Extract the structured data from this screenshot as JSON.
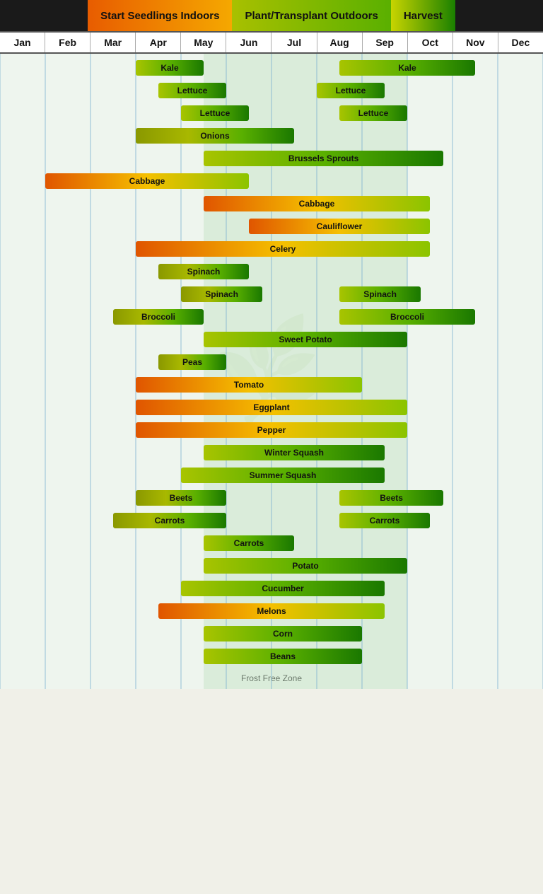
{
  "legend": {
    "items": [
      {
        "label": "Start Seedlings Indoors",
        "type": "seedlings"
      },
      {
        "label": "Plant/Transplant Outdoors",
        "type": "plant"
      },
      {
        "label": "Harvest",
        "type": "harvest"
      }
    ]
  },
  "months": [
    "Jan",
    "Feb",
    "Mar",
    "Apr",
    "May",
    "Jun",
    "Jul",
    "Aug",
    "Sep",
    "Oct",
    "Nov",
    "Dec"
  ],
  "footer": "Frost Free Zone",
  "chart": {
    "total_months": 12,
    "rows": [
      {
        "label": "Kale",
        "bars": [
          {
            "start": 3.0,
            "end": 4.5,
            "type": "plant",
            "label": "Kale"
          },
          {
            "start": 7.5,
            "end": 10.5,
            "type": "plant",
            "label": "Kale"
          }
        ]
      },
      {
        "label": "Lettuce1",
        "bars": [
          {
            "start": 3.5,
            "end": 5.0,
            "type": "plant",
            "label": "Lettuce"
          },
          {
            "start": 7.0,
            "end": 8.5,
            "type": "plant",
            "label": "Lettuce"
          }
        ]
      },
      {
        "label": "Lettuce2",
        "bars": [
          {
            "start": 4.0,
            "end": 5.5,
            "type": "plant",
            "label": "Lettuce"
          },
          {
            "start": 7.5,
            "end": 9.0,
            "type": "plant",
            "label": "Lettuce"
          }
        ]
      },
      {
        "label": "Onions",
        "bars": [
          {
            "start": 3.0,
            "end": 6.5,
            "type": "olive",
            "label": "Onions"
          }
        ]
      },
      {
        "label": "Brussels Sprouts",
        "bars": [
          {
            "start": 4.5,
            "end": 9.8,
            "type": "plant",
            "label": "Brussels Sprouts"
          }
        ]
      },
      {
        "label": "Cabbage1",
        "bars": [
          {
            "start": 1.0,
            "end": 5.5,
            "type": "seedling",
            "label": "Cabbage"
          }
        ]
      },
      {
        "label": "Cabbage2",
        "bars": [
          {
            "start": 4.5,
            "end": 9.5,
            "type": "seedling",
            "label": "Cabbage"
          }
        ]
      },
      {
        "label": "Cauliflower",
        "bars": [
          {
            "start": 5.5,
            "end": 9.5,
            "type": "seedling",
            "label": "Cauliflower"
          }
        ]
      },
      {
        "label": "Celery",
        "bars": [
          {
            "start": 3.0,
            "end": 9.5,
            "type": "seedling",
            "label": "Celery"
          }
        ]
      },
      {
        "label": "Spinach1",
        "bars": [
          {
            "start": 3.5,
            "end": 5.5,
            "type": "olive",
            "label": "Spinach"
          }
        ]
      },
      {
        "label": "Spinach2",
        "bars": [
          {
            "start": 4.0,
            "end": 5.8,
            "type": "olive",
            "label": "Spinach"
          },
          {
            "start": 7.5,
            "end": 9.3,
            "type": "plant",
            "label": "Spinach"
          }
        ]
      },
      {
        "label": "Broccoli",
        "bars": [
          {
            "start": 2.5,
            "end": 4.5,
            "type": "olive",
            "label": "Broccoli"
          },
          {
            "start": 7.5,
            "end": 10.5,
            "type": "plant",
            "label": "Broccoli"
          }
        ]
      },
      {
        "label": "Sweet Potato",
        "bars": [
          {
            "start": 4.5,
            "end": 9.0,
            "type": "plant",
            "label": "Sweet Potato"
          }
        ]
      },
      {
        "label": "Peas",
        "bars": [
          {
            "start": 3.5,
            "end": 5.0,
            "type": "olive",
            "label": "Peas"
          }
        ]
      },
      {
        "label": "Tomato",
        "bars": [
          {
            "start": 3.0,
            "end": 8.0,
            "type": "seedling",
            "label": "Tomato"
          }
        ]
      },
      {
        "label": "Eggplant",
        "bars": [
          {
            "start": 3.0,
            "end": 9.0,
            "type": "seedling",
            "label": "Eggplant"
          }
        ]
      },
      {
        "label": "Pepper",
        "bars": [
          {
            "start": 3.0,
            "end": 9.0,
            "type": "seedling",
            "label": "Pepper"
          }
        ]
      },
      {
        "label": "Winter Squash",
        "bars": [
          {
            "start": 4.5,
            "end": 8.5,
            "type": "plant",
            "label": "Winter Squash"
          }
        ]
      },
      {
        "label": "Summer Squash",
        "bars": [
          {
            "start": 4.0,
            "end": 8.5,
            "type": "plant",
            "label": "Summer Squash"
          }
        ]
      },
      {
        "label": "Beets",
        "bars": [
          {
            "start": 3.0,
            "end": 5.0,
            "type": "olive",
            "label": "Beets"
          },
          {
            "start": 7.5,
            "end": 9.8,
            "type": "plant",
            "label": "Beets"
          }
        ]
      },
      {
        "label": "Carrots1",
        "bars": [
          {
            "start": 2.5,
            "end": 5.0,
            "type": "olive",
            "label": "Carrots"
          },
          {
            "start": 7.5,
            "end": 9.5,
            "type": "plant",
            "label": "Carrots"
          }
        ]
      },
      {
        "label": "Carrots2",
        "bars": [
          {
            "start": 4.5,
            "end": 6.5,
            "type": "plant",
            "label": "Carrots"
          }
        ]
      },
      {
        "label": "Potato",
        "bars": [
          {
            "start": 4.5,
            "end": 9.0,
            "type": "plant",
            "label": "Potato"
          }
        ]
      },
      {
        "label": "Cucumber",
        "bars": [
          {
            "start": 4.0,
            "end": 8.5,
            "type": "plant",
            "label": "Cucumber"
          }
        ]
      },
      {
        "label": "Melons",
        "bars": [
          {
            "start": 3.5,
            "end": 8.5,
            "type": "seedling",
            "label": "Melons"
          }
        ]
      },
      {
        "label": "Corn",
        "bars": [
          {
            "start": 4.5,
            "end": 8.0,
            "type": "plant",
            "label": "Corn"
          }
        ]
      },
      {
        "label": "Beans",
        "bars": [
          {
            "start": 4.5,
            "end": 8.0,
            "type": "plant",
            "label": "Beans"
          }
        ]
      }
    ]
  },
  "colors": {
    "seedling_start": "#e05500",
    "seedling_end": "#8bc400",
    "plant_start": "#a8c400",
    "plant_end": "#1a7800",
    "harvest_start": "#c8d400",
    "harvest_end": "#1a7800",
    "olive_start": "#8a9800",
    "olive_end": "#1a5800",
    "dark_start": "#6a9000",
    "dark_end": "#1a5800",
    "frost_zone": "rgba(180,220,180,0.35)",
    "grid_line": "#7ab0d0"
  }
}
